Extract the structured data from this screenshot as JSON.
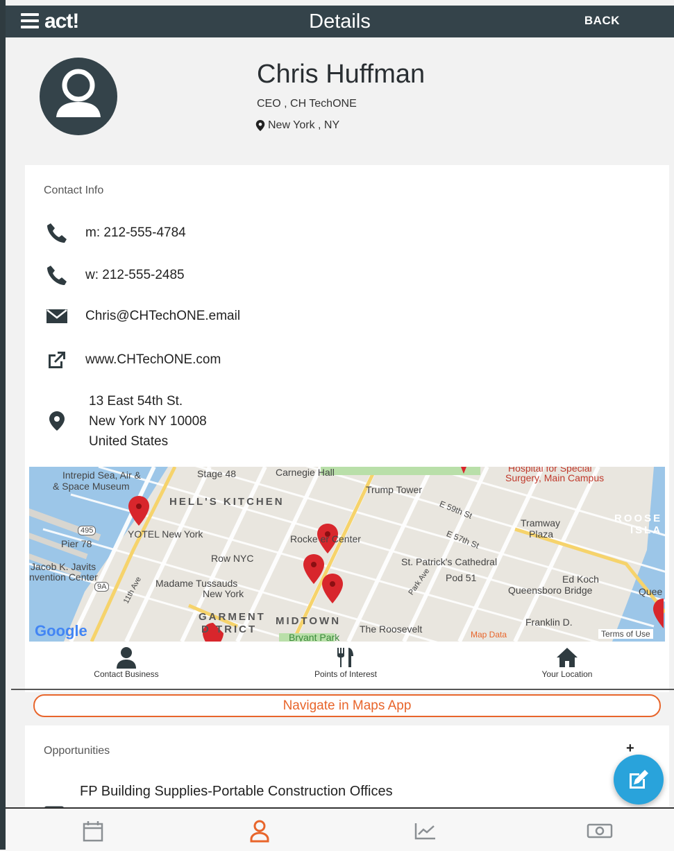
{
  "header": {
    "logo": "act!",
    "title": "Details",
    "back_label": "BACK"
  },
  "profile": {
    "name": "Chris Huffman",
    "role": "CEO , CH TechONE",
    "location": "New York , NY"
  },
  "contact": {
    "section_title": "Contact Info",
    "mobile": "m: 212-555-4784",
    "work": "w: 212-555-2485",
    "email": "Chris@CHTechONE.email",
    "website": "www.CHTechONE.com",
    "address": {
      "line1": "13 East 54th St.",
      "line2": "New York NY 10008",
      "line3": "United States"
    }
  },
  "map": {
    "labels": {
      "intrepid": "Intrepid Sea, Air &",
      "intrepid2": "& Space Museum",
      "stage48": "Stage 48",
      "carnegie": "Carnegie Hall",
      "hospital": "Hospital for Special",
      "hospital2": "Surgery, Main Campus",
      "trump": "Trump Tower",
      "hells": "HELL'S KITCHEN",
      "e59": "E 59th St",
      "tramway": "Tramway",
      "tramway2": "Plaza",
      "roose": "ROOSE",
      "isla": "ISLA",
      "r495": "495",
      "pier": "Pier 78",
      "yotel": "YOTEL New York",
      "rocke": "Rocke   er Center",
      "e57": "E 57th St",
      "rownyc": "Row NYC",
      "stpat": "St. Patrick's Cathedral",
      "javits": "Jacob K. Javits",
      "javits2": "nvention Center",
      "parkave": "Park Ave",
      "pod51": "Pod 51",
      "edkoch": "Ed Koch",
      "queensboro": "Queensboro Bridge",
      "quee": "Quee",
      "r9a": "9A",
      "tussauds": "Madame Tussauds",
      "tussauds2": "New York",
      "ave11": "11th Ave",
      "garment": "GARMENT",
      "district": "D  TRICT",
      "midtown": "MIDTOWN",
      "bryant": "Bryant Park",
      "roosevelt": "The Roosevelt",
      "franklin": "Franklin D.",
      "mapdata": "Map Data",
      "terms": "Terms of Use",
      "google": "Google"
    },
    "tabs": {
      "contact_business": "Contact Business",
      "points_of_interest": "Points of Interest",
      "your_location": "Your Location"
    }
  },
  "navigate_label": "Navigate in Maps App",
  "opportunities": {
    "section_title": "Opportunities",
    "plus": "+",
    "item": "FP Building Supplies-Portable Construction Offices"
  },
  "colors": {
    "header": "#34434a",
    "accent": "#e8652b",
    "fab": "#29a3db"
  }
}
